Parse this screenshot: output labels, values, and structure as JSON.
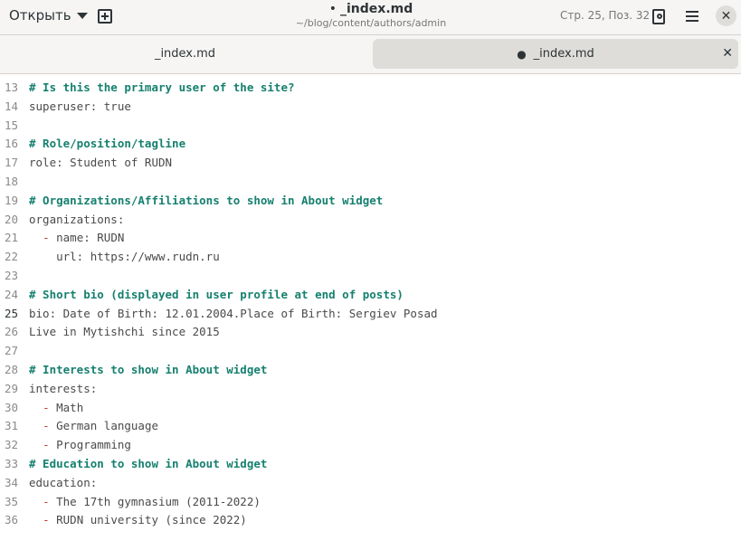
{
  "header": {
    "open_label": "Открыть",
    "title_dot": "•",
    "title": "_index.md",
    "path": "~/blog/content/authors/admin",
    "cursor_position": "Стр. 25, Поз. 32",
    "close_label": "✕"
  },
  "tabs": [
    {
      "label": "_index.md",
      "modified": false
    },
    {
      "label": "_index.md",
      "modified": true,
      "dot": "●",
      "close": "✕"
    }
  ],
  "editor": {
    "current_line": 25,
    "lines": [
      {
        "n": "13",
        "text": "# Is this the primary user of the site?"
      },
      {
        "n": "14",
        "text": "superuser: true"
      },
      {
        "n": "15",
        "text": ""
      },
      {
        "n": "16",
        "text": "# Role/position/tagline"
      },
      {
        "n": "17",
        "text": "role: Student of RUDN"
      },
      {
        "n": "18",
        "text": ""
      },
      {
        "n": "19",
        "text": "# Organizations/Affiliations to show in About widget"
      },
      {
        "n": "20",
        "text": "organizations:"
      },
      {
        "n": "21",
        "text": "  - name: RUDN"
      },
      {
        "n": "22",
        "text": "    url: https://www.rudn.ru"
      },
      {
        "n": "23",
        "text": ""
      },
      {
        "n": "24",
        "text": "# Short bio (displayed in user profile at end of posts)"
      },
      {
        "n": "25",
        "text": "bio: Date of Birth: 12.01.2004.Place of Birth: Sergiev Posad"
      },
      {
        "n": "26",
        "text": "Live in Mytishchi since 2015"
      },
      {
        "n": "27",
        "text": ""
      },
      {
        "n": "28",
        "text": "# Interests to show in About widget"
      },
      {
        "n": "29",
        "text": "interests:"
      },
      {
        "n": "30",
        "text": "  - Math"
      },
      {
        "n": "31",
        "text": "  - German language"
      },
      {
        "n": "32",
        "text": "  - Programming"
      },
      {
        "n": "33",
        "text": "# Education to show in About widget"
      },
      {
        "n": "34",
        "text": "education:"
      },
      {
        "n": "35",
        "text": "  - The 17th gymnasium (2011-2022)"
      },
      {
        "n": "36",
        "text": "  - RUDN university (since 2022)"
      }
    ]
  },
  "colors": {
    "comment": "#16806f",
    "list_dash": "#c0392b",
    "spell_underline": "#c01c28",
    "headerbar_bg": "#f6f5f4",
    "active_tab_bg": "#deddda"
  },
  "icons": {
    "open_dropdown": "chevron-down-icon",
    "new_tab": "new-tab-icon",
    "document_stats": "document-search-icon",
    "menu": "hamburger-menu-icon",
    "close": "close-icon"
  }
}
